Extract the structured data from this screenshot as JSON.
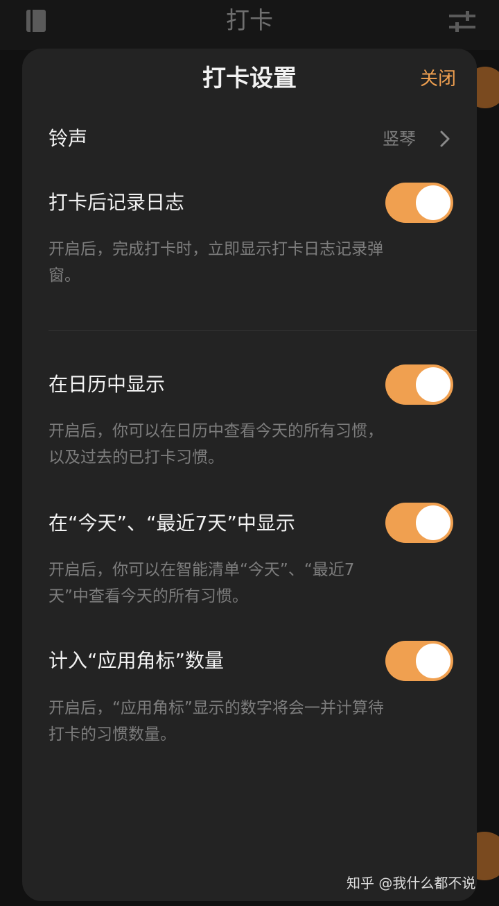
{
  "background": {
    "title": "打卡",
    "icons": {
      "left": "notebook-icon",
      "right": "sliders-icon"
    }
  },
  "sheet": {
    "title": "打卡设置",
    "close_label": "关闭",
    "ringtone": {
      "label": "铃声",
      "value": "竖琴"
    },
    "settings": [
      {
        "label": "打卡后记录日志",
        "on": true,
        "desc_lines": [
          "开启后，完成打卡时，立即显示打卡日志记录弹",
          "窗。"
        ]
      },
      {
        "label": "在日历中显示",
        "on": true,
        "desc_lines": [
          "开启后，你可以在日历中查看今天的所有习惯，",
          "以及过去的已打卡习惯。"
        ]
      },
      {
        "label": "在“今天”、“最近7天”中显示",
        "on": true,
        "desc_lines": [
          "开启后，你可以在智能清单“今天”、“最近7",
          "天”中查看今天的所有习惯。"
        ]
      },
      {
        "label": "计入“应用角标”数量",
        "on": true,
        "desc_lines": [
          "开启后，“应用角标”显示的数字将会一并计算待",
          "打卡的习惯数量。"
        ]
      }
    ]
  },
  "watermark": "知乎 @我什么都不说",
  "colors": {
    "accent": "#f0a050",
    "sheet_bg": "#232323",
    "text_primary": "#f2f2f2",
    "text_secondary": "#7d7d7d"
  }
}
